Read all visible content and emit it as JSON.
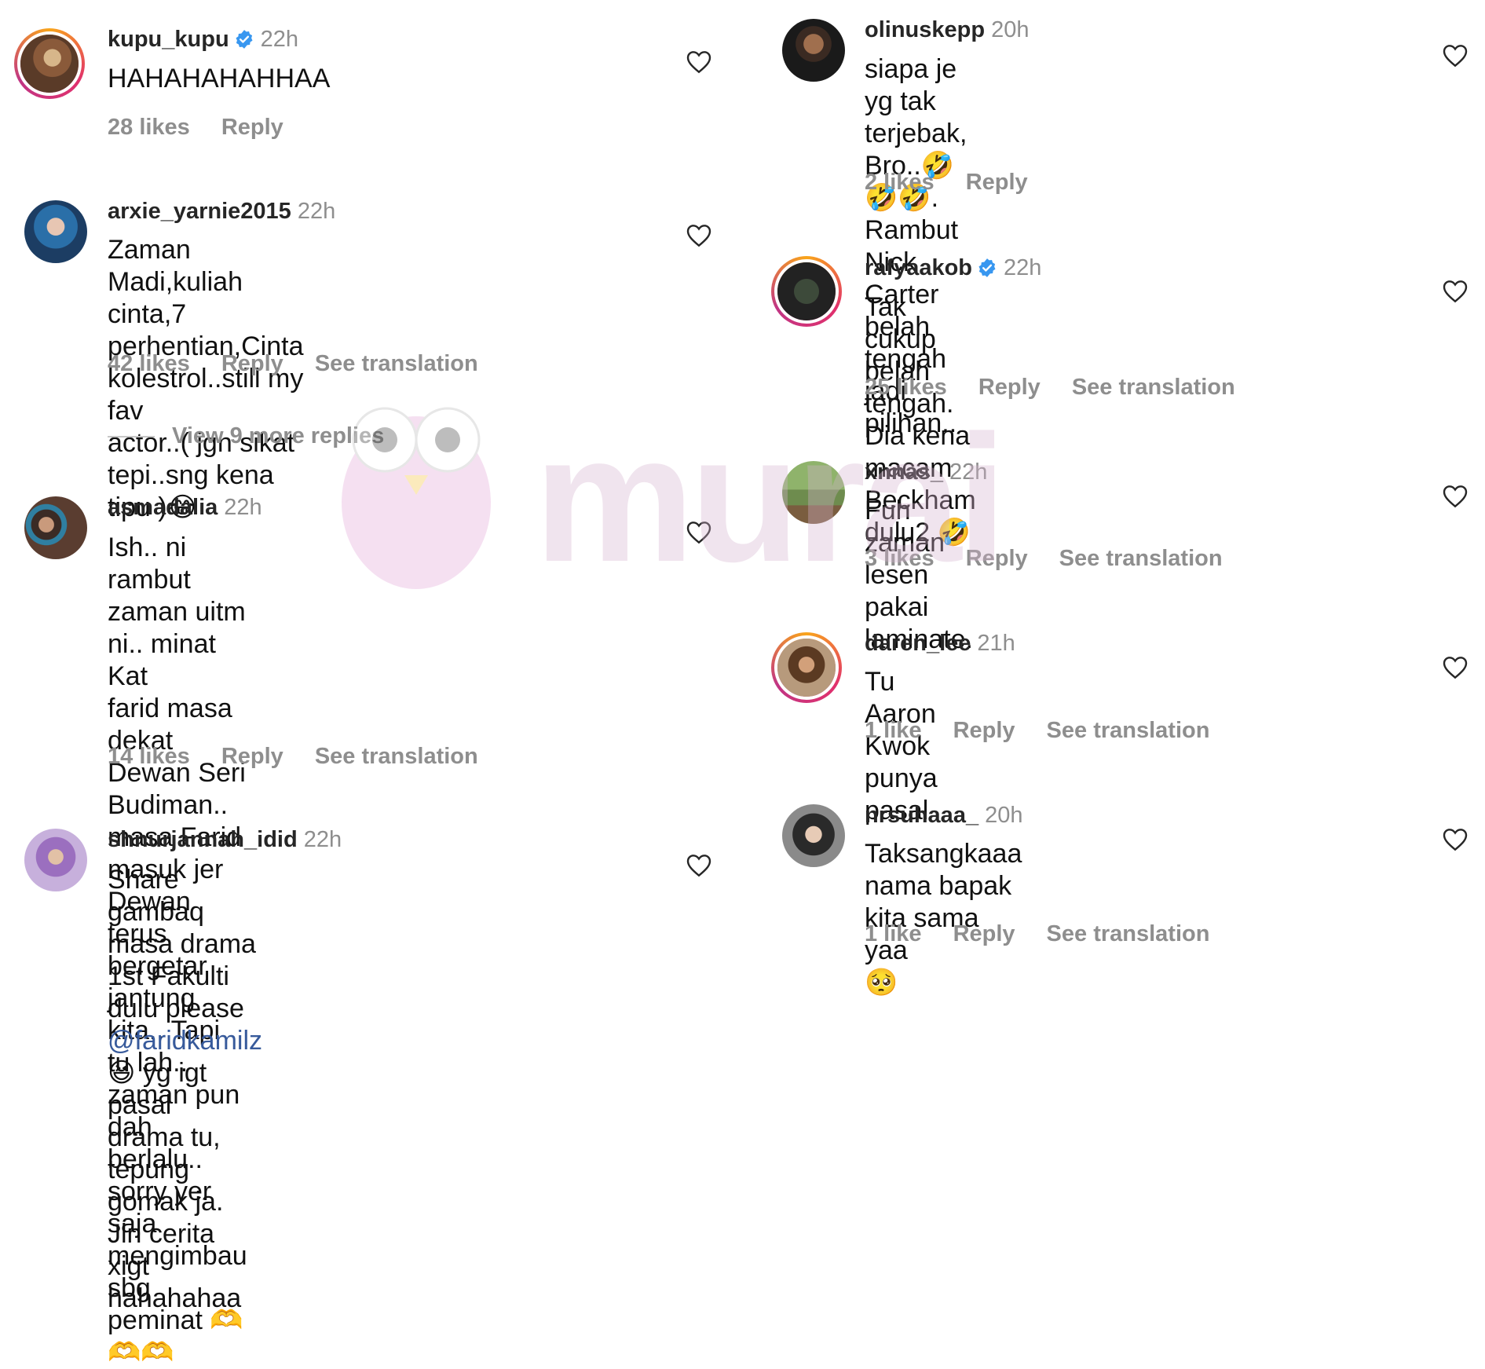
{
  "watermark": {
    "brand": "murai"
  },
  "left_column": {
    "comments": [
      {
        "username": "kupu_kupu",
        "verified": true,
        "time": "22h",
        "text": "HAHAHAHAHHAA",
        "likes": "28 likes",
        "reply": "Reply"
      },
      {
        "username": "arxie_yarnie2015",
        "time": "22h",
        "line1": "Zaman Madi,kuliah cinta,7",
        "line2": "perhentian,Cinta kolestrol..still my fav",
        "line3": "actor..( jgn sikat tepi..sng kena tipu )",
        "emoji": "😂",
        "likes": "42 likes",
        "reply": "Reply",
        "translate": "See translation"
      },
      {
        "view_more": "View 9 more replies"
      },
      {
        "username": "asmadalia",
        "time": "22h",
        "line1": "Ish.. ni rambut zaman uitm ni.. minat Kat",
        "line2": "farid masa dekat Dewan Seri Budiman..",
        "line3": "masa Farid masuk jer Dewan terus",
        "line4": "bergetar jantung kita.. Tapi tu lah..",
        "line5": "zaman pun dah berlalu.. sorry yer saja",
        "line6": "mengimbau sbg peminat",
        "emoji": "🫶🫶🫶",
        "likes": "14 likes",
        "reply": "Reply",
        "translate": "See translation"
      },
      {
        "username": "shnurjannah_idid",
        "time": "22h",
        "line1": "Share gambaq masa drama 1st Fakulti",
        "line2_a": "dulu please",
        "mention": "@faridkamilz",
        "emoji": "😆",
        "line2_b": "yg igt pasal",
        "line3": "drama tu, tepung gomak ja. Jln cerita",
        "line4": "xigt hahahahaa"
      }
    ]
  },
  "right_column": {
    "comments": [
      {
        "username": "olinuskepp",
        "time": "20h",
        "line1": "siapa je yg tak terjebak, Bro..",
        "emoji": "🤣🤣🤣",
        "line1_end": ".",
        "line2": "Rambut Nick Carter belah tengah jadi",
        "line3": "pilihan..",
        "likes": "2 likes",
        "reply": "Reply"
      },
      {
        "username": "rafyaakob",
        "verified": true,
        "time": "22h",
        "line1": "Tak cukup belah tengah. Dia kena",
        "line2": "macam Beckham dulu2",
        "emoji": "🤣",
        "likes": "25 likes",
        "reply": "Reply",
        "translate": "See translation"
      },
      {
        "username": "xnnas_",
        "time": "22h",
        "text": "Fuh zaman lesen pakai laminate.",
        "likes": "3 likes",
        "reply": "Reply",
        "translate": "See translation"
      },
      {
        "username": "daren_lee",
        "time": "21h",
        "text": "Tu Aaron Kwok punya pasal",
        "likes": "1 like",
        "reply": "Reply",
        "translate": "See translation"
      },
      {
        "username": "nrsuhaaa_",
        "time": "20h",
        "text": "Taksangkaaa nama bapak kita sama yaa",
        "emoji": "🥺",
        "likes": "1 like",
        "reply": "Reply",
        "translate": "See translation"
      }
    ]
  }
}
